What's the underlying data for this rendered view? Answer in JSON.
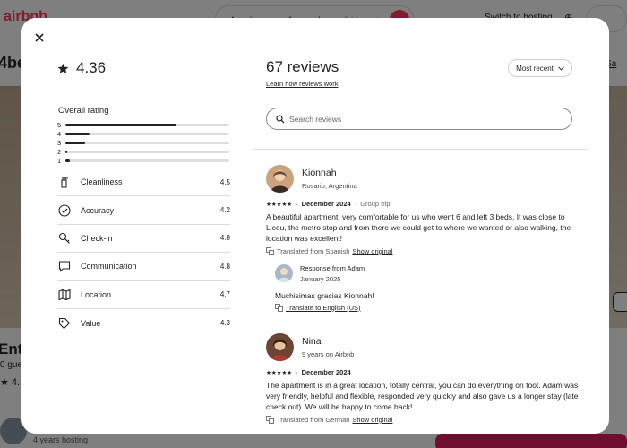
{
  "background": {
    "logo": "airbnb",
    "search": {
      "anywhere": "Anywhere",
      "anyweek": "Any week",
      "guests": "Add guests"
    },
    "switch_hosting": "Switch to hosting",
    "title_fragment": "4be",
    "save_fragment": "Sa",
    "entire_fragment": "Entir",
    "guests_fragment": "0 gue",
    "rating_fragment": "★ 4.3",
    "hosting": "4 years hosting"
  },
  "modal": {
    "close_icon": "close-icon",
    "overall_score": "4.36",
    "overall_label": "Overall rating",
    "distribution": [
      {
        "stars": "5",
        "fraction": 0.68
      },
      {
        "stars": "4",
        "fraction": 0.15
      },
      {
        "stars": "3",
        "fraction": 0.12
      },
      {
        "stars": "2",
        "fraction": 0.01
      },
      {
        "stars": "1",
        "fraction": 0.03
      }
    ],
    "categories": [
      {
        "label": "Cleanliness",
        "value": "4.5",
        "icon": "spray-bottle-icon"
      },
      {
        "label": "Accuracy",
        "value": "4.2",
        "icon": "check-circle-icon"
      },
      {
        "label": "Check-in",
        "value": "4.8",
        "icon": "key-icon"
      },
      {
        "label": "Communication",
        "value": "4.8",
        "icon": "chat-bubble-icon"
      },
      {
        "label": "Location",
        "value": "4.7",
        "icon": "map-icon"
      },
      {
        "label": "Value",
        "value": "4.3",
        "icon": "tag-icon"
      }
    ],
    "reviews_title": "67 reviews",
    "learn_link": "Learn how reviews work",
    "sort_label": "Most recent",
    "search_placeholder": "Search reviews",
    "reviews": [
      {
        "name": "Kionnah",
        "location": "Rosario, Argentina",
        "stars": "★★★★★",
        "date": "December 2024",
        "trip": "Group trip",
        "text": "A beautiful apartment, very comfortable for us who went 6 and left 3 beds. It was close to Liceu, the metro stop and from there we could get to where we wanted or also walking, the location was excellent!",
        "translated": "Translated from Spanish",
        "show_original": "Show original",
        "response": {
          "title": "Response from Adam",
          "date": "January 2025",
          "text": "Muchisimas gracias Kionnah!",
          "translate": "Translate to English (US)"
        }
      },
      {
        "name": "Nina",
        "location": "9 years on Airbnb",
        "stars": "★★★★★",
        "date": "December 2024",
        "text": "The apartment is in a great location, totally central, you can do everything on foot. Adam was very friendly, helpful and flexible, responded very quickly and also gave us a longer stay (late check out). We will be happy to come back!",
        "translated": "Translated from German",
        "show_original": "Show original"
      }
    ]
  }
}
